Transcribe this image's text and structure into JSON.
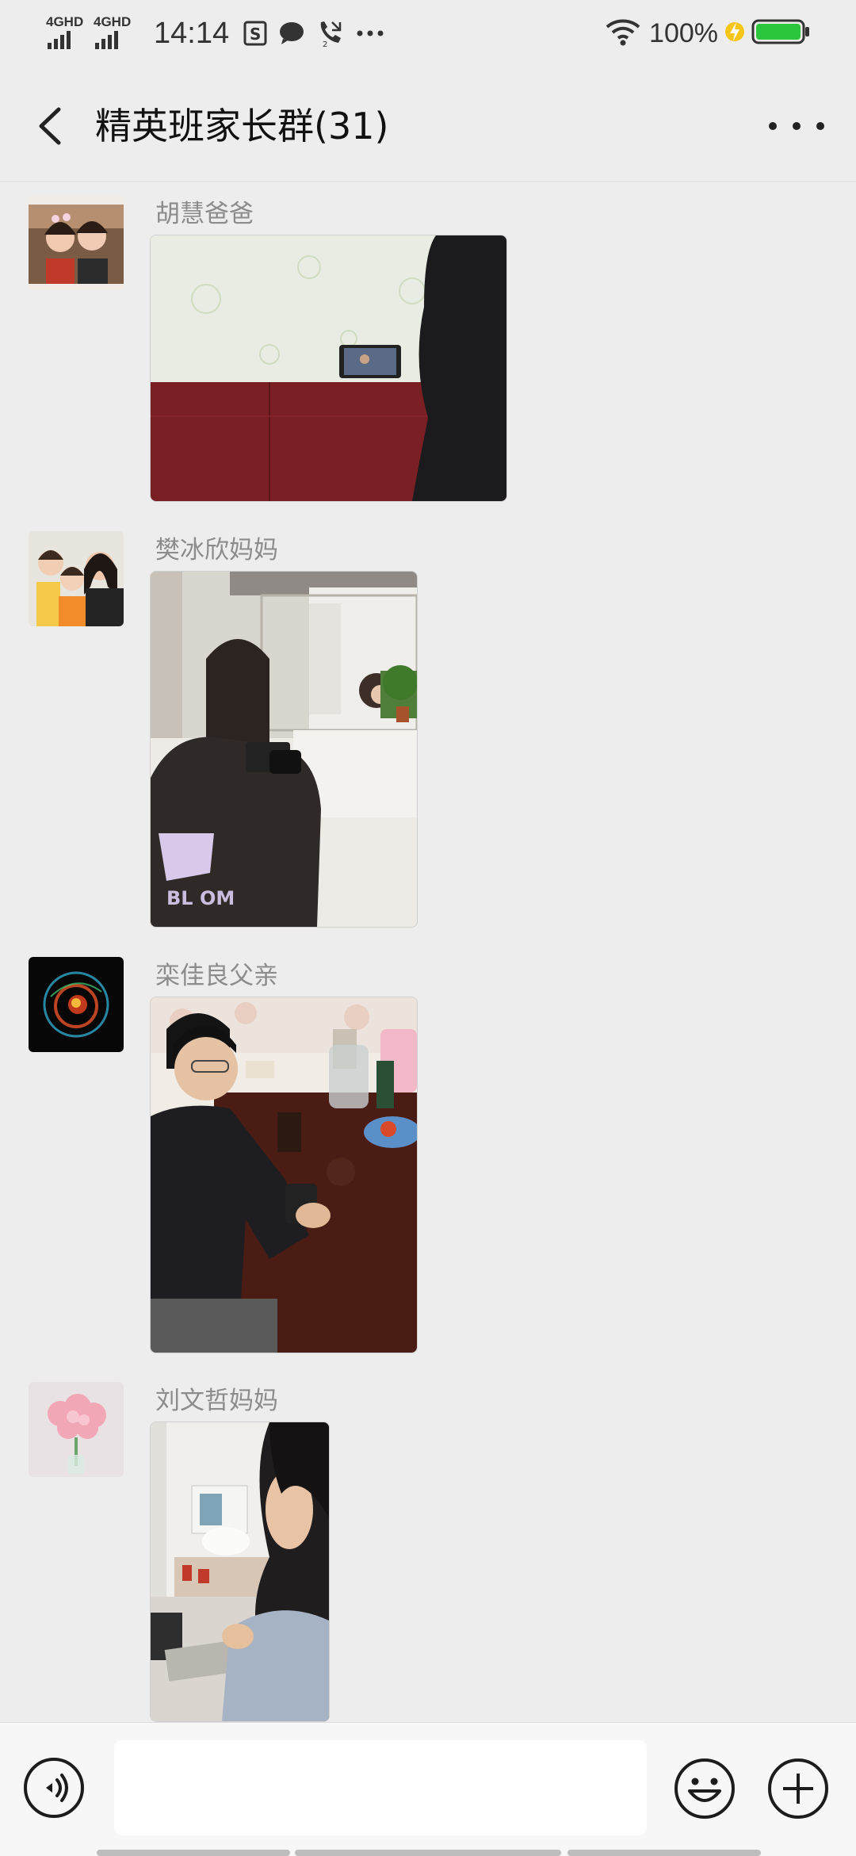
{
  "status_bar": {
    "network_1": "4GHD",
    "network_2": "4GHD",
    "time": "14:14",
    "battery_percent": "100%",
    "icons": [
      "signal-icon",
      "signal-icon",
      "sim-icon",
      "chat-bubble-icon",
      "missed-call-icon",
      "more-dots-icon",
      "wifi-icon",
      "charging-icon",
      "battery-icon"
    ]
  },
  "header": {
    "title": "精英班家长群(31)",
    "back_icon": "chevron-left-icon",
    "more_icon": "more-icon"
  },
  "messages": [
    {
      "sender": "胡慧爸爸",
      "avatar": "avatar-two-girls",
      "content": "photo"
    },
    {
      "sender": "樊冰欣妈妈",
      "avatar": "avatar-three-people",
      "content": "photo"
    },
    {
      "sender": "栾佳良父亲",
      "avatar": "avatar-abstract-light",
      "content": "photo"
    },
    {
      "sender": "刘文哲妈妈",
      "avatar": "avatar-flowers",
      "content": "photo"
    }
  ],
  "input_bar": {
    "voice_icon": "voice-icon",
    "text_value": "",
    "emoji_icon": "emoji-icon",
    "plus_icon": "plus-icon"
  },
  "colors": {
    "background": "#ededed",
    "sender_gray": "#8c8c8c",
    "battery_green": "#2bc63b",
    "charging_yellow": "#f5c518"
  }
}
